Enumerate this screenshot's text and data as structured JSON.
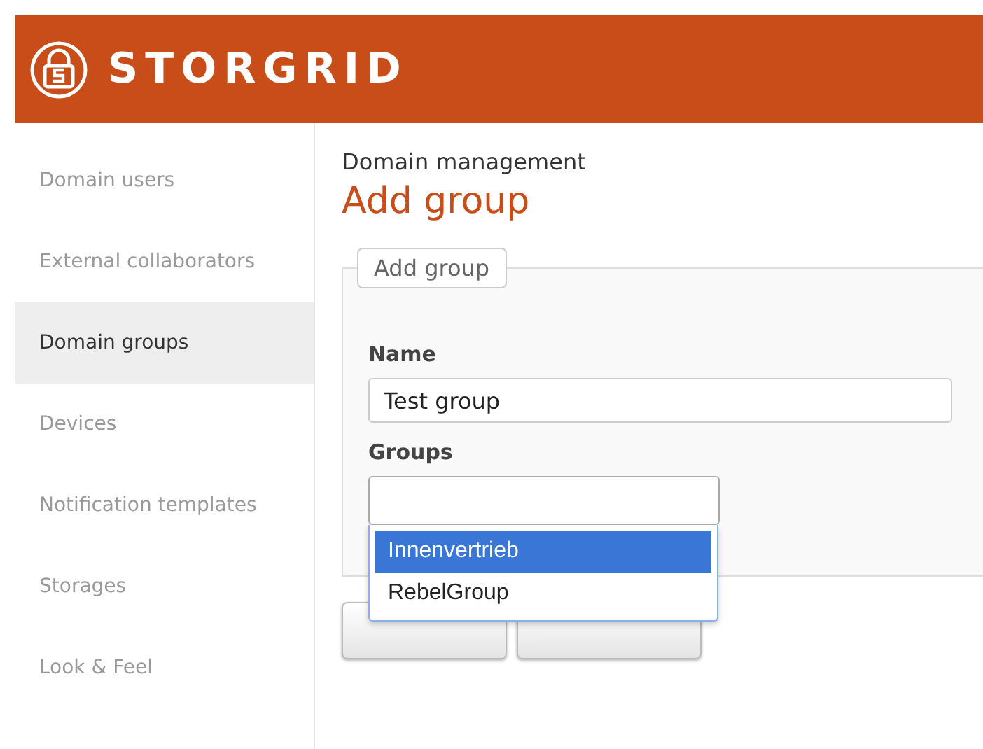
{
  "header": {
    "brand": "STORGRID"
  },
  "sidebar": {
    "items": [
      {
        "label": "Domain users",
        "selected": false
      },
      {
        "label": "External collaborators",
        "selected": false
      },
      {
        "label": "Domain groups",
        "selected": true
      },
      {
        "label": "Devices",
        "selected": false
      },
      {
        "label": "Notification templates",
        "selected": false
      },
      {
        "label": "Storages",
        "selected": false
      },
      {
        "label": "Look & Feel",
        "selected": false
      }
    ]
  },
  "page": {
    "breadcrumb": "Domain management",
    "title": "Add group"
  },
  "form": {
    "legend": "Add group",
    "fields": [
      {
        "label": "Name",
        "value": "Test group"
      },
      {
        "label": "Groups"
      }
    ],
    "dropdown": {
      "options": [
        {
          "label": "Innenvertrieb",
          "selected": true
        },
        {
          "label": "RebelGroup",
          "selected": false
        }
      ]
    },
    "buttons": [
      {
        "kind": "save"
      },
      {
        "kind": "cancel"
      }
    ]
  }
}
